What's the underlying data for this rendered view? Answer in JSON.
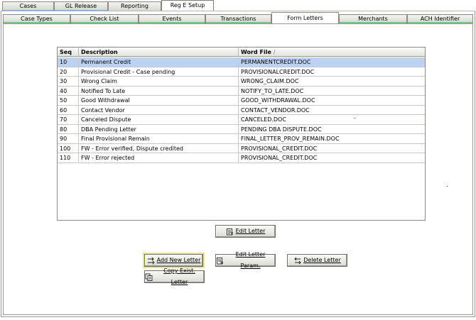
{
  "top_tabs": [
    "Cases",
    "GL Release",
    "Reporting",
    "Reg E Setup"
  ],
  "sub_tabs": [
    "Case Types",
    "Check List",
    "Events",
    "Transactions",
    "Form Letters",
    "Merchants",
    "ACH Identifier"
  ],
  "grid": {
    "columns": {
      "seq": "Seq",
      "description": "Description",
      "word_file": "Word File"
    },
    "sort_indicator": "/",
    "rows": [
      {
        "seq": "10",
        "description": "Permanent Credit",
        "word_file": "PERMANENTCREDIT.DOC"
      },
      {
        "seq": "20",
        "description": "Provisional Credit - Case pending",
        "word_file": "PROVISIONALCREDIT.DOC"
      },
      {
        "seq": "30",
        "description": "Wrong Claim",
        "word_file": "WRONG_CLAIM.DOC"
      },
      {
        "seq": "40",
        "description": "Notified To Late",
        "word_file": "NOTIFY_TO_LATE.DOC"
      },
      {
        "seq": "50",
        "description": "Good Withdrawal",
        "word_file": "GOOD_WITHDRAWAL.DOC"
      },
      {
        "seq": "60",
        "description": "Contact Vendor",
        "word_file": "CONTACT_VENDOR.DOC"
      },
      {
        "seq": "70",
        "description": "Canceled Dispute",
        "word_file": "CANCELED.DOC"
      },
      {
        "seq": "80",
        "description": "DBA Pending Letter",
        "word_file": "PENDING DBA DISPUTE.DOC"
      },
      {
        "seq": "90",
        "description": "Final Provisional Remain",
        "word_file": "FINAL_LETTER_PROV_REMAIN.DOC"
      },
      {
        "seq": "100",
        "description": "FW - Error verified, Dispute credited",
        "word_file": "PROVISIONAL_CREDIT.DOC"
      },
      {
        "seq": "110",
        "description": "FW - Error rejected",
        "word_file": "PROVISIONAL_CREDIT.DOC"
      }
    ]
  },
  "buttons": {
    "edit_letter": "Edit Letter",
    "add_new_letter": "Add New Letter",
    "edit_letter_param": "Edit Letter Param.",
    "delete_letter": "Delete Letter",
    "copy_exist_letter": "Copy Exist. Letter"
  },
  "icons": {
    "edit_letter": "document-edit-icon",
    "add_new_letter": "add-arrow-icon",
    "edit_letter_param": "document-param-icon",
    "delete_letter": "delete-arrow-icon",
    "copy_exist_letter": "document-copy-icon"
  },
  "colors": {
    "selected_row": "#bcd2f0",
    "focus_outline": "#f0e870"
  }
}
